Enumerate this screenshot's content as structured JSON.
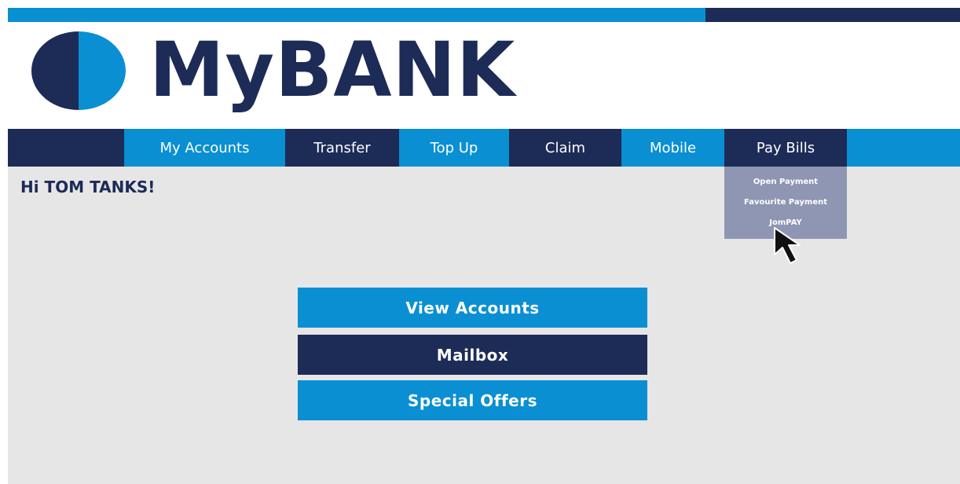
{
  "colors": {
    "brand_dark": "#1d2b57",
    "brand_light": "#0a8fd3",
    "background": "#e6e6e6",
    "dropdown": "#8f96b3"
  },
  "logo": {
    "text": "MyBANK",
    "icon": "half-circle-logo-icon"
  },
  "nav": {
    "items": [
      {
        "label": "My Accounts"
      },
      {
        "label": "Transfer"
      },
      {
        "label": "Top Up"
      },
      {
        "label": "Claim"
      },
      {
        "label": "Mobile"
      },
      {
        "label": "Pay Bills"
      }
    ]
  },
  "greeting": "Hi TOM TANKS!",
  "pay_bills_menu": {
    "items": [
      {
        "label": "Open Payment"
      },
      {
        "label": "Favourite Payment"
      },
      {
        "label": "JomPAY"
      }
    ]
  },
  "actions": {
    "view_accounts": "View Accounts",
    "mailbox": "Mailbox",
    "special_offers": "Special Offers"
  }
}
